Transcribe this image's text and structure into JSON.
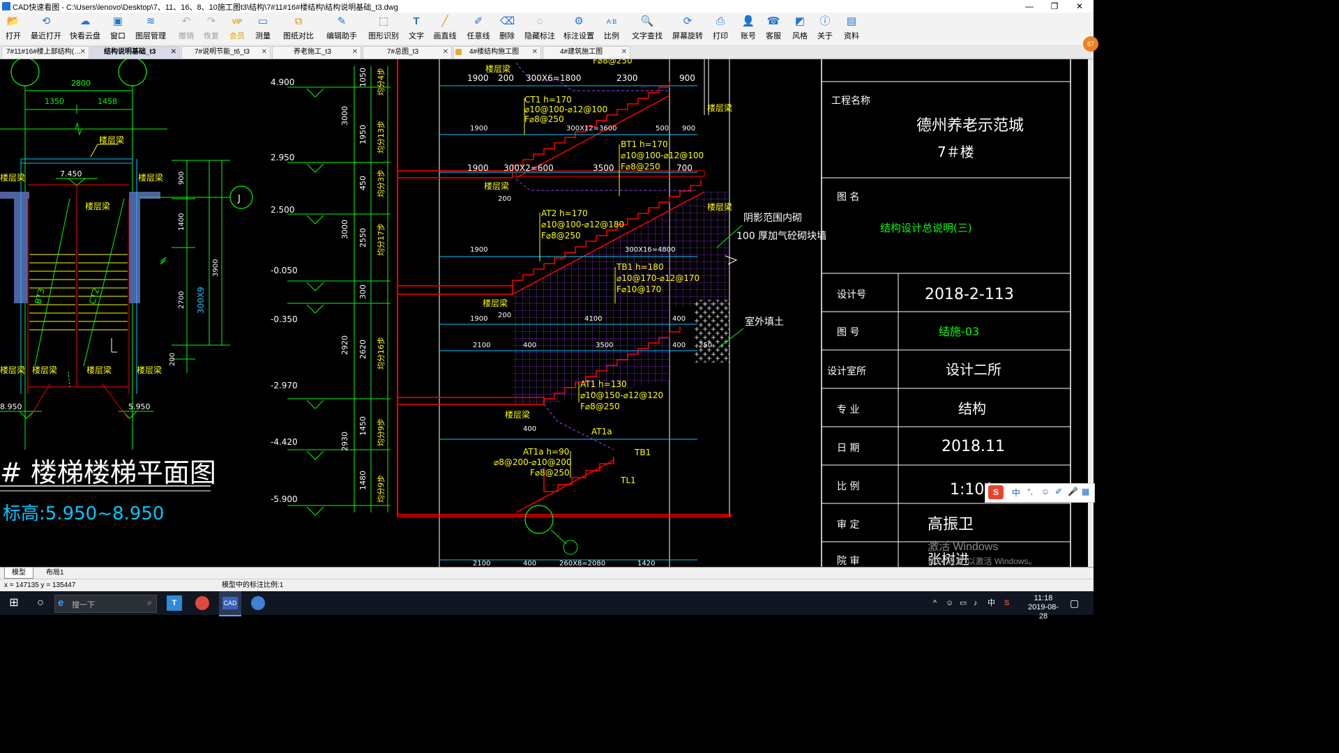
{
  "window": {
    "title": "CAD快速看图 - C:\\Users\\lenovo\\Desktop\\7、11、16、8、10施工图t3\\结构\\7#11#16#楼结构\\结构说明基础_t3.dwg",
    "minimize": "—",
    "restore": "❐",
    "close": "✕"
  },
  "toolbar": {
    "items": [
      {
        "label": "打开",
        "icon": "📂"
      },
      {
        "label": "最近打开",
        "icon": "⟲"
      },
      {
        "label": "快看云盘",
        "icon": "☁"
      },
      {
        "label": "窗口",
        "icon": "▣"
      },
      {
        "label": "图层管理",
        "icon": "≋"
      },
      {
        "label": "撤销",
        "icon": "↶"
      },
      {
        "label": "恢复",
        "icon": "↷"
      },
      {
        "label": "会员",
        "icon": "VIP"
      },
      {
        "label": "测量",
        "icon": "▭"
      },
      {
        "label": "图纸对比",
        "icon": "⧉"
      },
      {
        "label": "编辑助手",
        "icon": "✎"
      },
      {
        "label": "图形识别",
        "icon": "⬚"
      },
      {
        "label": "文字",
        "icon": "T"
      },
      {
        "label": "画直线",
        "icon": "╱"
      },
      {
        "label": "任意线",
        "icon": "✐"
      },
      {
        "label": "删除",
        "icon": "⌫"
      },
      {
        "label": "隐藏标注",
        "icon": "◌"
      },
      {
        "label": "标注设置",
        "icon": "⚙"
      },
      {
        "label": "比例",
        "icon": "A:B"
      },
      {
        "label": "文字查找",
        "icon": "🔍"
      },
      {
        "label": "屏幕旋转",
        "icon": "⟳"
      },
      {
        "label": "打印",
        "icon": "⎙"
      },
      {
        "label": "账号",
        "icon": "👤"
      },
      {
        "label": "客服",
        "icon": "☎"
      },
      {
        "label": "风格",
        "icon": "◩"
      },
      {
        "label": "关于",
        "icon": "ⓘ"
      },
      {
        "label": "资料",
        "icon": "▤"
      }
    ]
  },
  "tabs": [
    {
      "label": "7#11#16#楼上部结构(…"
    },
    {
      "label": "结构说明基础_t3"
    },
    {
      "label": "7#说明节能_t6_t3"
    },
    {
      "label": "养老施工_t3"
    },
    {
      "label": "7#总图_t3"
    },
    {
      "label": "4#楼结构施工图"
    },
    {
      "label": "4#建筑施工图"
    }
  ],
  "drawing": {
    "plan": {
      "dims_top": [
        "2800",
        "1350",
        "1458"
      ],
      "right_dims": [
        "900",
        "1400",
        "3900",
        "2700",
        "300X9",
        "200"
      ],
      "labels": [
        "楼层梁",
        "楼层梁",
        "楼层梁",
        "楼层梁",
        "楼层梁",
        "楼层梁",
        "楼层梁",
        "楼层梁"
      ],
      "level": "7.450",
      "stair1": "BT3",
      "stair2": "CT2",
      "grid": "J",
      "left_level": "8.950",
      "right_level": "5.950",
      "title": "# 楼梯楼梯平面图",
      "subtitle": "标高:5.950~8.950"
    },
    "section": {
      "levels": [
        "4.900",
        "2.950",
        "2.500",
        "-0.050",
        "-0.350",
        "-2.970",
        "-4.420",
        "-5.900"
      ],
      "dims_a": [
        "3000",
        "3000",
        "2920",
        "2930"
      ],
      "dims_b": [
        "1050",
        "1950",
        "450",
        "2550",
        "300",
        "2620",
        "1450",
        "1480"
      ],
      "steps": [
        "均分4步",
        "均分13步",
        "均分3步",
        "均分17步",
        "均分16步",
        "均分9步",
        "均分9步"
      ],
      "beam": "楼层梁",
      "row1": [
        "1900",
        "200",
        "300X6=1800",
        "2300",
        "900"
      ],
      "row2": [
        "1900",
        "300X12=3600",
        "500",
        "900"
      ],
      "row3": [
        "1900",
        "300X2=600",
        "3500",
        "700"
      ],
      "row4": [
        "200",
        "1900",
        "300X16=4800"
      ],
      "row5": [
        "200",
        "1900",
        "4100",
        "400"
      ],
      "row6": [
        "2100",
        "400",
        "3500",
        "400",
        "250"
      ],
      "row7": [
        "400"
      ],
      "row8": [
        "2100",
        "400",
        "260X8=2080",
        "1420"
      ],
      "f_top": "F⌀8@250",
      "ct1": [
        "CT1 h=170",
        "⌀10@100-⌀12@100",
        "F⌀8@250"
      ],
      "bt1": [
        "BT1 h=170",
        "⌀10@100-⌀12@100",
        "F⌀8@250"
      ],
      "at2": [
        "AT2 h=170",
        "⌀10@100-⌀12@180",
        "F⌀8@250"
      ],
      "tb1": [
        "TB1 h=180",
        "⌀10@170-⌀12@170",
        "F⌀10@170"
      ],
      "at1": [
        "AT1 h=130",
        "⌀10@150-⌀12@120",
        "F⌀8@250"
      ],
      "at1a": [
        "AT1a h=90",
        "⌀8@200-⌀10@200",
        "F⌀8@250"
      ],
      "at1a_tag": "AT1a",
      "tb1_tag": "TB1",
      "tl1_tag": "TL1",
      "note_shade": "阴影范围内砌",
      "note_wall": "100  厚加气砼砌块墙",
      "note_fill": "室外填土"
    },
    "titleblock": {
      "project_label": "工程名称",
      "project_line1": "德州养老示范城",
      "project_line2": "7＃楼",
      "drawing_name_label": "图  名",
      "drawing_name": "结构设计总说明(三)",
      "design_no_label": "设计号",
      "design_no": "2018-2-113",
      "sheet_no_label": "图  号",
      "sheet_no": "结施-03",
      "office_label": "设计室所",
      "office": "设计二所",
      "discipline_label": "专  业",
      "discipline": "结构",
      "date_label": "日  期",
      "date": "2018.11",
      "scale_label": "比  例",
      "scale": "1:100",
      "approve_label": "审  定",
      "approve": "高振卫",
      "dean_label": "院  审",
      "dean": "张树进"
    }
  },
  "layout_tabs": [
    "模型",
    "布局1"
  ],
  "status": {
    "coords": "x = 147135  y = 135447",
    "scale_msg": "模型中的标注比例:1"
  },
  "watermark": {
    "line1": "激活 Windows",
    "line2": "转到\"设置\"以激活 Windows。"
  },
  "ime": {
    "items": [
      "中",
      "°,",
      "☺",
      "✐",
      "🎤",
      "▦"
    ]
  },
  "badge": "87",
  "taskbar": {
    "search_placeholder": "搜一下",
    "clock_time": "11:18",
    "clock_date": "2019-08-28",
    "ime_lang": "中",
    "ime_s": "S"
  },
  "colors": {
    "cad_background": "#000000",
    "cad_green": "#00ff00",
    "cad_yellow": "#ffff00",
    "cad_cyan": "#00c8ff",
    "cad_red": "#ff0000",
    "cad_magenta": "#b040ff",
    "cad_white": "#ffffff",
    "taskbar": "#101722"
  }
}
